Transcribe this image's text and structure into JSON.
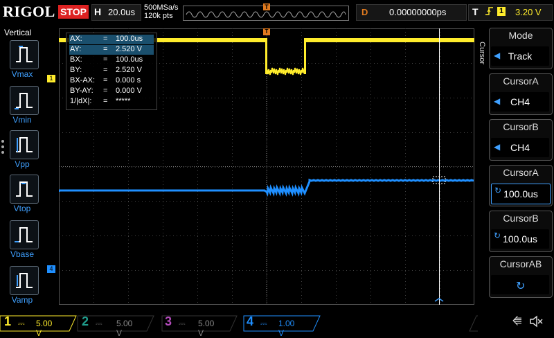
{
  "header": {
    "brand": "RIGOL",
    "run_state": "STOP",
    "timebase_letter": "H",
    "timebase": "20.0us",
    "sample_rate": "500MSa/s",
    "memory_depth": "120k pts",
    "delay_letter": "D",
    "delay": "0.00000000ps",
    "trigger_letter": "T",
    "trigger_source": "1",
    "trigger_level": "3.20 V",
    "trigger_pos_marker": "T"
  },
  "left_menu": {
    "title": "Vertical",
    "items": [
      {
        "label": "Vmax"
      },
      {
        "label": "Vmin"
      },
      {
        "label": "Vpp"
      },
      {
        "label": "Vtop"
      },
      {
        "label": "Vbase"
      },
      {
        "label": "Vamp"
      }
    ]
  },
  "cursor_info": {
    "rows": [
      {
        "name": "AX:",
        "eq": "=",
        "value": "100.0us",
        "selected": true
      },
      {
        "name": "AY:",
        "eq": "=",
        "value": "2.520 V",
        "selected": true
      },
      {
        "name": "BX:",
        "eq": "=",
        "value": "100.0us",
        "selected": false
      },
      {
        "name": "BY:",
        "eq": "=",
        "value": "2.520 V",
        "selected": false
      },
      {
        "name": "BX-AX:",
        "eq": "=",
        "value": "0.000 s",
        "selected": false
      },
      {
        "name": "BY-AY:",
        "eq": "=",
        "value": "0.000 V",
        "selected": false
      },
      {
        "name": "1/|dX|:",
        "eq": "=",
        "value": "*****",
        "selected": false
      }
    ]
  },
  "right_menu": {
    "side_label": "Cursor",
    "buttons": [
      {
        "title": "Mode",
        "value": "Track",
        "kind": "arrow"
      },
      {
        "title": "CursorA",
        "value": "CH4",
        "kind": "arrow"
      },
      {
        "title": "CursorB",
        "value": "CH4",
        "kind": "arrow"
      },
      {
        "title": "CursorA",
        "value": "100.0us",
        "kind": "knob"
      },
      {
        "title": "CursorB",
        "value": "100.0us",
        "kind": "knob"
      },
      {
        "title": "CursorAB",
        "value": "",
        "kind": "knob"
      }
    ]
  },
  "channels": [
    {
      "num": "1",
      "scale": "5.00 V",
      "color": "#ffec2c",
      "active": true
    },
    {
      "num": "2",
      "scale": "5.00 V",
      "color": "#1f9c8c",
      "active": false
    },
    {
      "num": "3",
      "scale": "5.00 V",
      "color": "#b04ab8",
      "active": false
    },
    {
      "num": "4",
      "scale": "1.00 V",
      "color": "#1f8fff",
      "active": true
    }
  ],
  "channel_markers": {
    "ch1": "1",
    "ch4": "4"
  },
  "colors": {
    "ch1": "#ffec2c",
    "ch4": "#1f8fff",
    "accent": "#e07a1f",
    "stop": "#dd2222"
  },
  "icons": {
    "usb": "usb-icon",
    "sound": "speaker-mute-icon"
  }
}
